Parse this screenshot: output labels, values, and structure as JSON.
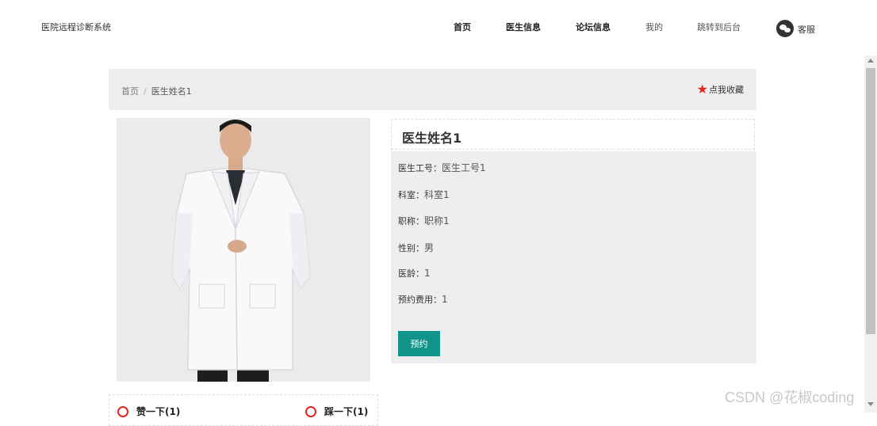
{
  "header": {
    "app_title": "医院远程诊断系统",
    "nav": [
      "首页",
      "医生信息",
      "论坛信息",
      "我的",
      "跳转到后台"
    ],
    "customer_service": "客服"
  },
  "breadcrumb": {
    "home": "首页",
    "separator": "/",
    "current": "医生姓名1"
  },
  "favorite": {
    "star": "★",
    "label": "点我收藏"
  },
  "doctor": {
    "name": "医生姓名1",
    "fields": [
      {
        "key": "医生工号：",
        "value": "医生工号1"
      },
      {
        "key": "科室：",
        "value": "科室1"
      },
      {
        "key": "职称：",
        "value": "职称1"
      },
      {
        "key": "性别：",
        "value": "男"
      },
      {
        "key": "医龄：",
        "value": "1"
      },
      {
        "key": "预约费用：",
        "value": "1"
      }
    ],
    "book_button": "预约"
  },
  "votes": {
    "like": "赞一下(1)",
    "dislike": "踩一下(1)"
  },
  "watermark": "CSDN @花椒coding",
  "colors": {
    "accent": "#11958a",
    "star": "#e1251b",
    "panel_bg": "#eeeeee"
  }
}
